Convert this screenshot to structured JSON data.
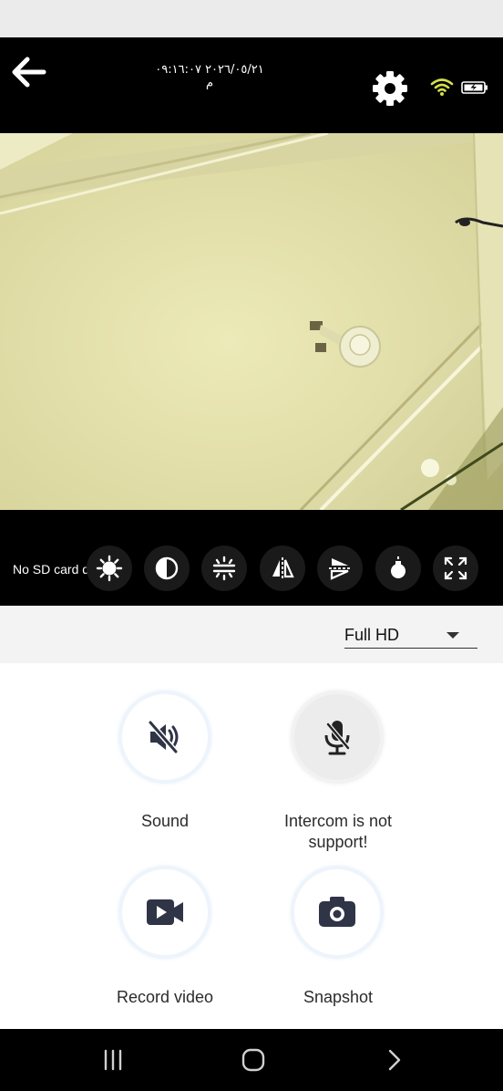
{
  "header": {
    "timestamp": "٢٠٢٦/٠٥/٢١ ٠٩:١٦:٠٧ م",
    "back_icon": "arrow-left-icon",
    "settings_icon": "gear-icon",
    "wifi_icon": "wifi-icon",
    "battery_icon": "battery-charging-icon"
  },
  "controls": {
    "sd_status": "No SD card detected",
    "buttons": [
      {
        "icon": "brightness-icon"
      },
      {
        "icon": "contrast-icon"
      },
      {
        "icon": "exposure-icon"
      },
      {
        "icon": "flip-horizontal-icon"
      },
      {
        "icon": "flip-vertical-icon"
      },
      {
        "icon": "night-light-icon"
      },
      {
        "icon": "fullscreen-icon"
      }
    ]
  },
  "quality": {
    "selected": "Full HD"
  },
  "actions": {
    "sound": "Sound",
    "intercom_line1": "Intercom is not",
    "intercom_line2": "support!",
    "record": "Record video",
    "snapshot": "Snapshot"
  },
  "colors": {
    "accent_icon": "#2f3447",
    "wifi": "#d4e04a",
    "video_wall": "#e2dfac"
  }
}
